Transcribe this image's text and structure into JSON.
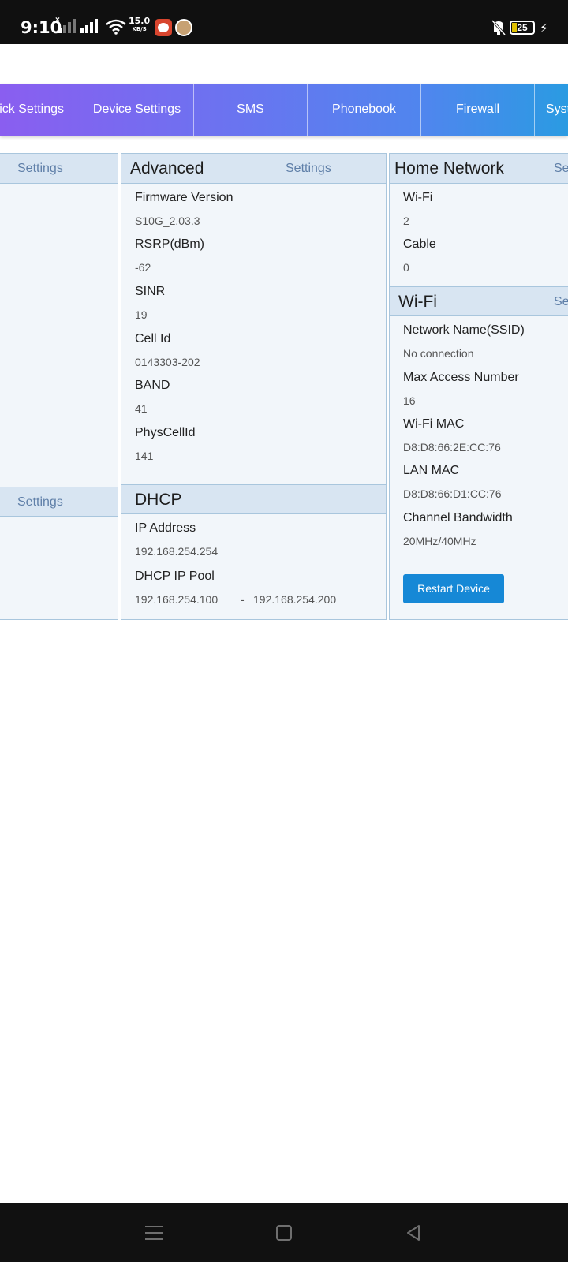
{
  "status_bar": {
    "time": "9:10",
    "speed_value": "15.0",
    "speed_unit": "KB/S",
    "battery_level": "25",
    "icons": [
      "signal-off-icon",
      "signal-icon",
      "wifi-icon",
      "app-notification-icon",
      "app-notification-icon",
      "mute-bell-icon",
      "battery-icon",
      "charging-bolt-icon"
    ]
  },
  "nav": {
    "tabs": [
      {
        "label": "Quick Settings"
      },
      {
        "label": "Device Settings"
      },
      {
        "label": "SMS"
      },
      {
        "label": "Phonebook"
      },
      {
        "label": "Firewall"
      },
      {
        "label": "System"
      }
    ]
  },
  "left_panel": {
    "top_link": "Settings",
    "bottom_link": "Settings"
  },
  "advanced": {
    "title": "Advanced",
    "link": "Settings",
    "rows": [
      {
        "label": "Firmware Version",
        "value": "S10G_2.03.3"
      },
      {
        "label": "RSRP(dBm)",
        "value": "-62"
      },
      {
        "label": "SINR",
        "value": "19"
      },
      {
        "label": "Cell Id",
        "value": "0143303-202"
      },
      {
        "label": "BAND",
        "value": "41"
      },
      {
        "label": "PhysCellId",
        "value": "141"
      }
    ]
  },
  "dhcp": {
    "title": "DHCP",
    "ip_label": "IP Address",
    "ip_value": "192.168.254.254",
    "pool_label": "DHCP IP Pool",
    "pool_start": "192.168.254.100",
    "pool_sep": "-",
    "pool_end": "192.168.254.200"
  },
  "home_network": {
    "title": "Home Network",
    "link": "Settings",
    "rows": [
      {
        "label": "Wi-Fi",
        "value": "2"
      },
      {
        "label": "Cable",
        "value": "0"
      }
    ]
  },
  "wifi": {
    "title": "Wi-Fi",
    "link": "Settings",
    "rows": [
      {
        "label": "Network Name(SSID)",
        "value": "No connection"
      },
      {
        "label": "Max Access Number",
        "value": "16"
      },
      {
        "label": "Wi-Fi MAC",
        "value": "D8:D8:66:2E:CC:76"
      },
      {
        "label": "LAN MAC",
        "value": "D8:D8:66:D1:CC:76"
      },
      {
        "label": "Channel Bandwidth",
        "value": "20MHz/40MHz"
      }
    ],
    "restart_label": "Restart Device"
  },
  "bottom_nav": {
    "icons": [
      "menu-icon",
      "home-square-icon",
      "back-triangle-icon"
    ]
  }
}
